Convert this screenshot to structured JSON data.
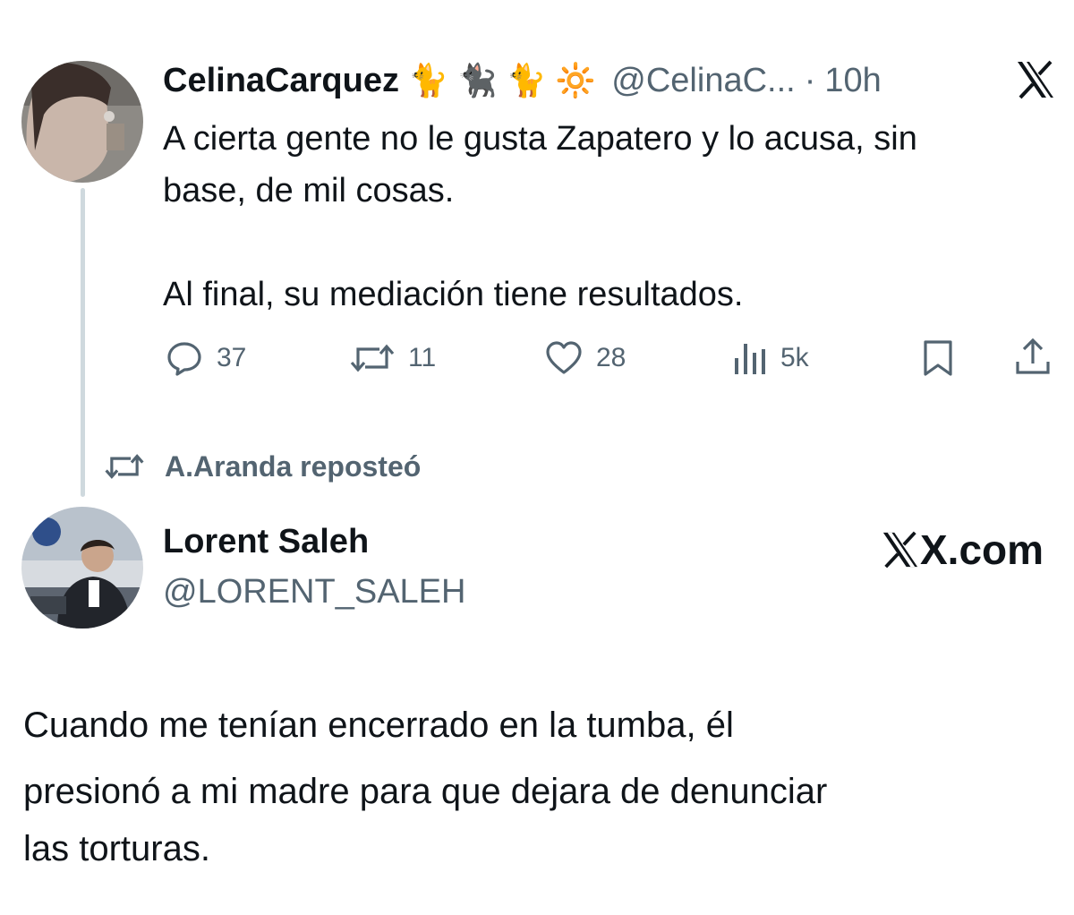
{
  "tweet1": {
    "display_name": "CelinaCarquez",
    "name_emojis": [
      "🐈",
      "🐈‍⬛",
      "🐈",
      "🔆"
    ],
    "handle": "@CelinaC...",
    "separator": "·",
    "time": "10h",
    "text_line1": "A cierta gente no le gusta Zapatero y lo acusa, sin",
    "text_line2": "base, de mil cosas.",
    "text_line3": "Al final, su mediación tiene resultados.",
    "replies": "37",
    "reposts": "11",
    "likes": "28",
    "views": "5k"
  },
  "repost_notice": "A.Aranda reposteó",
  "tweet2": {
    "display_name": "Lorent Saleh",
    "handle": "@LORENT_SALEH",
    "brand": "X.com",
    "text_line1": "Cuando me tenían encerrado en la tumba, él",
    "text_line2": "presionó a mi madre para que dejara de denunciar",
    "text_line3": "las torturas."
  },
  "icons": {
    "header": "x-logo-icon",
    "actions": [
      "reply-icon",
      "repost-icon",
      "like-icon",
      "views-icon",
      "bookmark-icon",
      "share-icon"
    ]
  },
  "colors": {
    "text": "#0f1419",
    "secondary": "#536471",
    "thread_line": "#cfd9de"
  }
}
